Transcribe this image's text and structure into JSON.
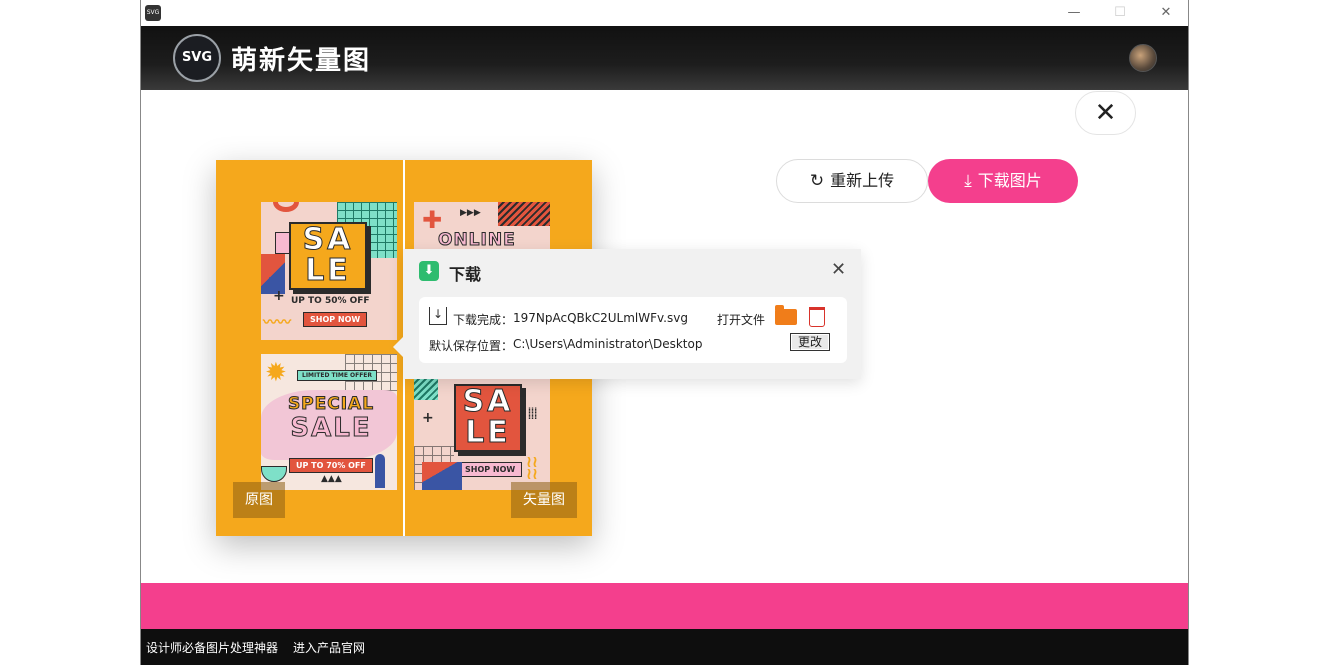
{
  "titlebar": {
    "app_icon_text": "SVG",
    "minimize": "—",
    "maximize": "☐",
    "close": "✕"
  },
  "header": {
    "logo_badge": "SVG",
    "logo_text": "萌新矢量图"
  },
  "main": {
    "close_symbol": "✕",
    "reupload_label": "重新上传",
    "download_label": "下载图片",
    "original_label": "原图",
    "vector_label": "矢量图"
  },
  "artwork": {
    "left_top": {
      "line1": "SA",
      "line2": "LE",
      "subtitle": "UP TO 50% OFF",
      "tag": "SHOP NOW"
    },
    "left_bottom": {
      "banner": "LIMITED TIME OFFER",
      "line1": "SPECIAL",
      "line2": "SALE",
      "tag": "UP TO 70% OFF"
    },
    "right_top": {
      "headline": "ONLINE"
    },
    "right_bottom": {
      "line1": "SA",
      "line2": "LE",
      "tag": "SHOP NOW"
    }
  },
  "download_popup": {
    "title": "下载",
    "close_symbol": "✕",
    "complete_label": "下载完成：",
    "filename": "197NpAcQBkC2ULmlWFv.svg",
    "open_file_label": "打开文件",
    "save_location_label": "默认保存位置：",
    "save_path": "C:\\Users\\Administrator\\Desktop",
    "change_label": "更改"
  },
  "footer": {
    "slogan": "设计师必备图片处理神器",
    "website_link": "进入产品官网"
  },
  "colors": {
    "accent_pink": "#f43f8d",
    "panel_orange": "#f5a81c",
    "success_green": "#2ebc6f",
    "folder_orange": "#f07d1a"
  }
}
